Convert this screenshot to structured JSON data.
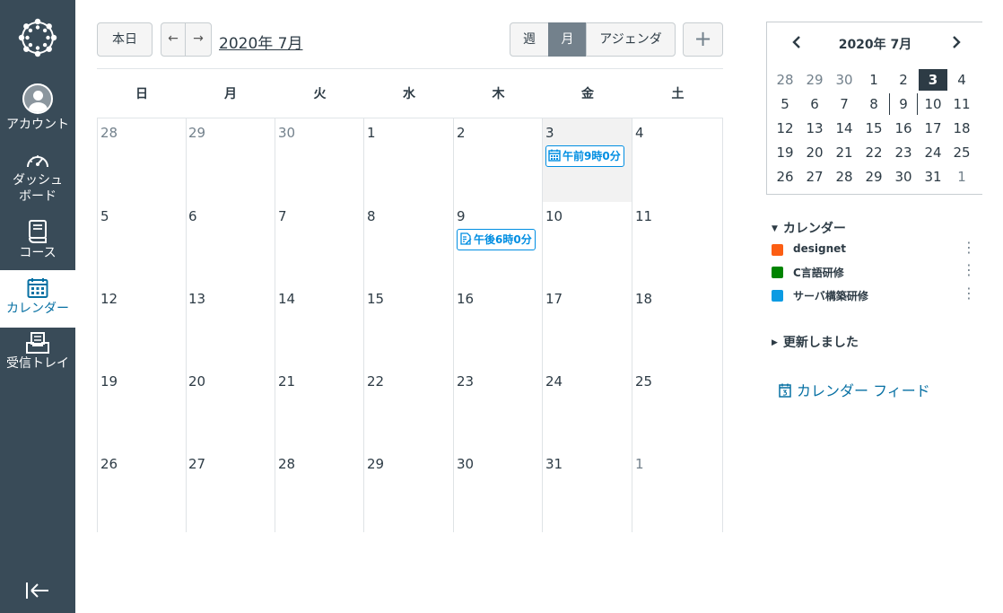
{
  "nav": {
    "account": "アカウント",
    "dashboard_1": "ダッシュ",
    "dashboard_2": "ボード",
    "courses": "コース",
    "calendar": "カレンダー",
    "inbox": "受信トレイ"
  },
  "toolbar": {
    "today": "本日",
    "prev": "←",
    "next": "→",
    "title": "2020年 7月",
    "views": {
      "week": "週",
      "month": "月",
      "agenda": "アジェンダ"
    },
    "selected_view": "月",
    "add": "+"
  },
  "grid": {
    "weekdays": [
      "日",
      "月",
      "火",
      "水",
      "木",
      "金",
      "土"
    ],
    "weeks": [
      [
        "28",
        "29",
        "30",
        "1",
        "2",
        "3",
        "4"
      ],
      [
        "5",
        "6",
        "7",
        "8",
        "9",
        "10",
        "11"
      ],
      [
        "12",
        "13",
        "14",
        "15",
        "16",
        "17",
        "18"
      ],
      [
        "19",
        "20",
        "21",
        "22",
        "23",
        "24",
        "25"
      ],
      [
        "26",
        "27",
        "28",
        "29",
        "30",
        "31",
        "1"
      ]
    ],
    "today": "3",
    "events": [
      {
        "day": "3",
        "label": "午前9時0分",
        "icon": "calendar-icon"
      },
      {
        "day": "9",
        "label": "午後6時0分",
        "icon": "assignment-icon"
      }
    ]
  },
  "mini_calendar": {
    "title": "2020年 7月",
    "weeks": [
      [
        "28",
        "29",
        "30",
        "1",
        "2",
        "3",
        "4"
      ],
      [
        "5",
        "6",
        "7",
        "8",
        "9",
        "10",
        "11"
      ],
      [
        "12",
        "13",
        "14",
        "15",
        "16",
        "17",
        "18"
      ],
      [
        "19",
        "20",
        "21",
        "22",
        "23",
        "24",
        "25"
      ],
      [
        "26",
        "27",
        "28",
        "29",
        "30",
        "31",
        "1"
      ]
    ],
    "today": "3",
    "marked": "9"
  },
  "calendars": {
    "header": "カレンダー",
    "items": [
      {
        "name": "designet",
        "color": "#fc5e13"
      },
      {
        "name": "C言語研修",
        "color": "#008400"
      },
      {
        "name": "サーバ構築研修",
        "color": "#0b9be3"
      }
    ]
  },
  "undated": {
    "header": "更新しました"
  },
  "feed": {
    "label": "カレンダー フィード"
  }
}
